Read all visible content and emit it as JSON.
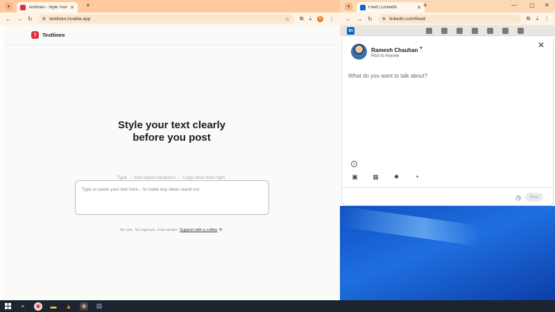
{
  "left_window": {
    "tab_title": "Textlineo - Style Your Text Beautifully",
    "url": "textlineo.lovable.app",
    "brand": "Textlineo",
    "logo_letter": "t",
    "hero_line1": "Style your text clearly",
    "hero_line2": "before you post",
    "subtitle": "Type → See styled variations → Copy what feels right.",
    "input_placeholder": "Type or paste your text here... to make key ideas stand out",
    "footer_text": "No ads. No signups. Just simple.",
    "footer_link": "Support with a coffee"
  },
  "right_window": {
    "tab_title": "Feed | LinkedIn",
    "url": "linkedin.com/feed/",
    "modal": {
      "user_name": "Ramesh Chauhan",
      "post_to": "Post to Anyone",
      "prompt": "What do you want to talk about?",
      "post_button": "Post"
    }
  },
  "colors": {
    "textlineo_red": "#d9333f",
    "linkedin_blue": "#0a66c2",
    "chrome_tab_strip": "#ffc99b"
  },
  "icons": [
    "search-icon",
    "chrome-icon",
    "folder-icon",
    "vlc-icon",
    "calendar-icon",
    "image-icon",
    "clock-icon",
    "close-icon",
    "emoji-icon",
    "plus-icon",
    "coffee-icon"
  ]
}
